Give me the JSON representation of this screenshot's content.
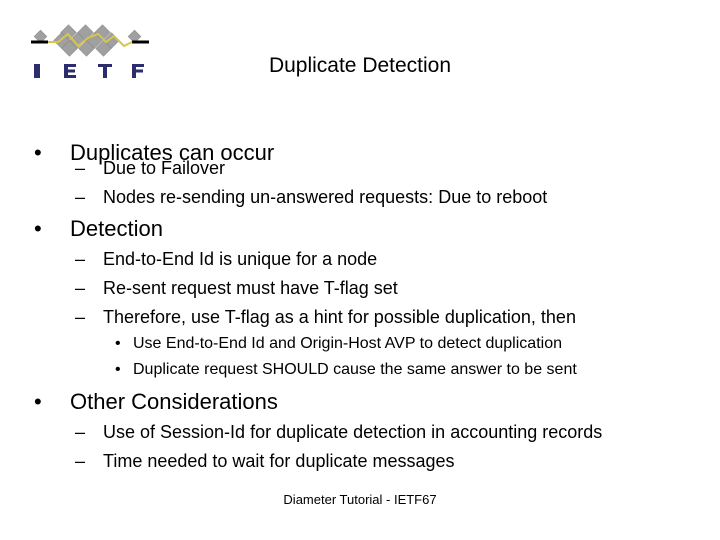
{
  "slide": {
    "logo_text": "IETF",
    "title": "Duplicate Detection",
    "footer": "Diameter Tutorial - IETF67",
    "bullets": [
      {
        "text": "Duplicates can occur",
        "children": [
          {
            "text": "Due to Failover"
          },
          {
            "text": "Nodes re-sending un-answered requests: Due to reboot"
          }
        ]
      },
      {
        "text": "Detection",
        "children": [
          {
            "text": "End-to-End Id is unique for a node"
          },
          {
            "text": "Re-sent request must have T-flag set"
          },
          {
            "text": "Therefore, use T-flag as a hint for possible duplication, then",
            "children": [
              {
                "text": "Use End-to-End Id and Origin-Host AVP to detect duplication"
              },
              {
                "text": "Duplicate request SHOULD cause the same answer to be sent"
              }
            ]
          }
        ]
      },
      {
        "text": "Other Considerations",
        "children": [
          {
            "text": "Use of Session-Id for duplicate detection in accounting records"
          },
          {
            "text": "Time needed to wait for duplicate messages"
          }
        ]
      }
    ],
    "markers": {
      "level1": "•",
      "level2": "–",
      "level3": "•"
    },
    "colors": {
      "logo_letters": "#2b2d6e",
      "logo_tiles": "#9a9a9a",
      "logo_line": "#d8c64a"
    }
  }
}
